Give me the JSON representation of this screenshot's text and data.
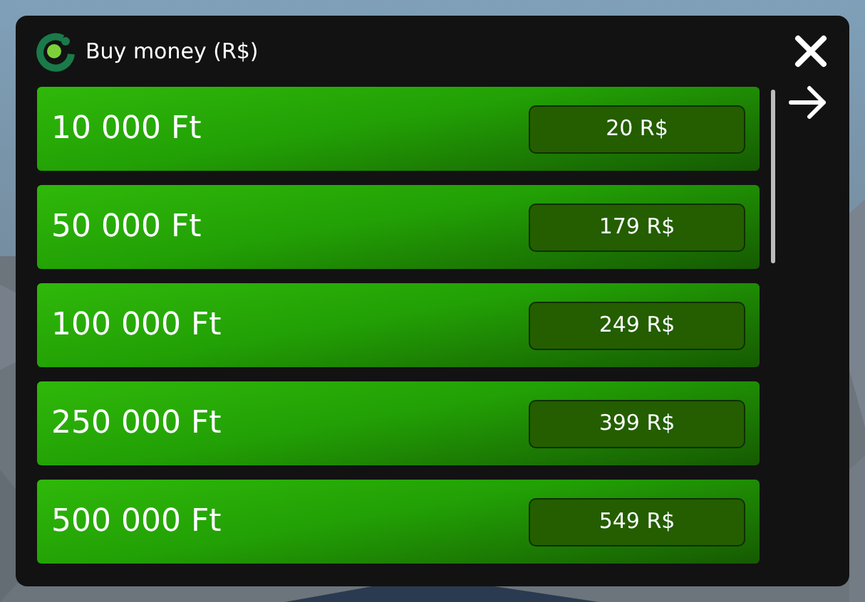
{
  "window": {
    "title": "Buy money (R$)"
  },
  "offers": [
    {
      "amount": "10 000 Ft",
      "price": "20 R$"
    },
    {
      "amount": "50 000 Ft",
      "price": "179 R$"
    },
    {
      "amount": "100 000 Ft",
      "price": "249 R$"
    },
    {
      "amount": "250 000 Ft",
      "price": "399 R$"
    },
    {
      "amount": "500 000 Ft",
      "price": "549 R$"
    }
  ]
}
